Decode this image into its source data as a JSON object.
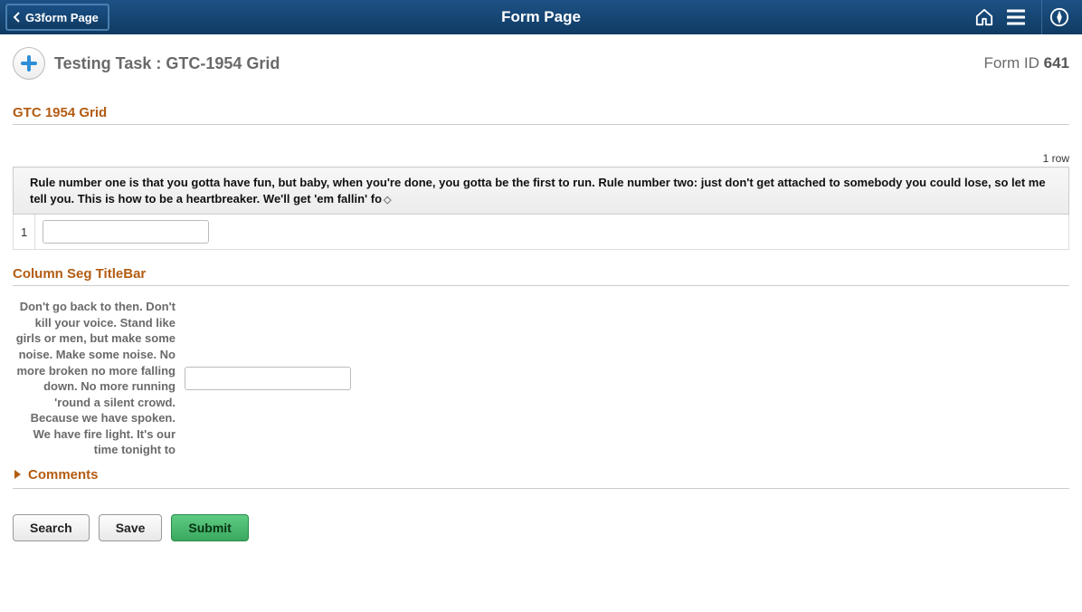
{
  "banner": {
    "back_label": "G3form Page",
    "title": "Form Page"
  },
  "header": {
    "title": "Testing Task :  GTC-1954 Grid",
    "form_id_label": "Form ID",
    "form_id_value": "641"
  },
  "section1": {
    "title": "GTC 1954 Grid",
    "row_count_label": "1 row",
    "column_header": "Rule number one is that you gotta have fun, but baby, when you're done, you gotta be the first to run. Rule number two: just don't get attached to somebody you could lose, so let me tell you. This is how to be a heartbreaker. We'll get 'em fallin' fo",
    "rows": [
      {
        "index": "1",
        "value": ""
      }
    ]
  },
  "section2": {
    "title": "Column Seg TitleBar",
    "field_label": "Don't go back to then. Don't kill your voice. Stand like girls or men, but make some noise. Make some noise. No more broken no more falling down. No more running 'round a silent crowd. Because we have spoken. We have fire light. It's our time tonight to",
    "field_value": ""
  },
  "comments": {
    "label": "Comments"
  },
  "buttons": {
    "search": "Search",
    "save": "Save",
    "submit": "Submit"
  }
}
